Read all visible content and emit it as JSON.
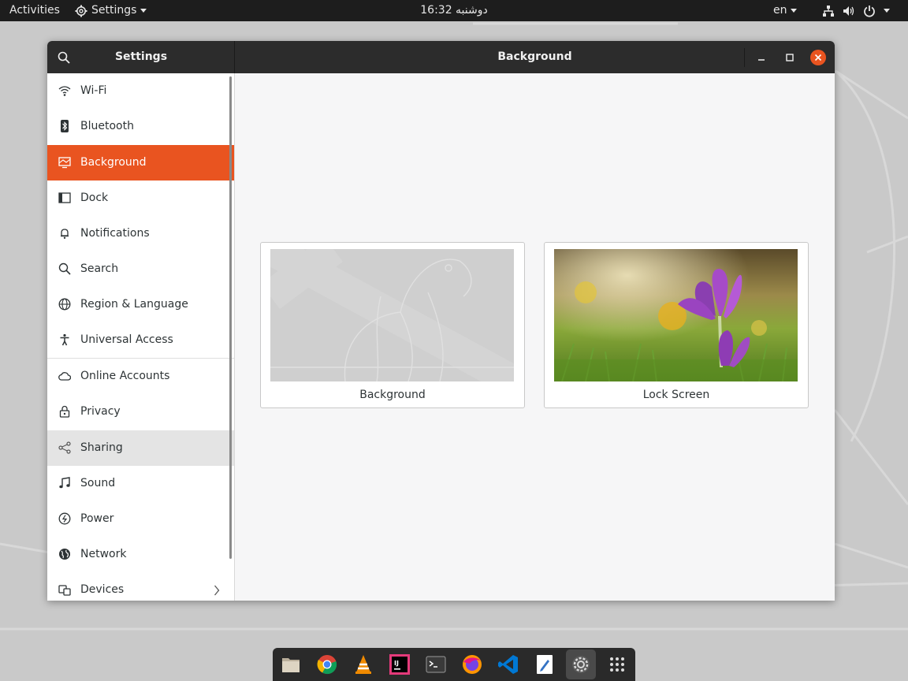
{
  "topbar": {
    "activities": "Activities",
    "app_menu": "Settings",
    "clock": "16:32 دوشنبه",
    "language": "en"
  },
  "window": {
    "sidebar_title": "Settings",
    "panel_title": "Background"
  },
  "sidebar": {
    "items": [
      {
        "label": "Wi-Fi",
        "icon": "wifi-icon"
      },
      {
        "label": "Bluetooth",
        "icon": "bluetooth-icon"
      },
      {
        "label": "Background",
        "icon": "background-icon",
        "state": "selected"
      },
      {
        "label": "Dock",
        "icon": "dock-icon"
      },
      {
        "label": "Notifications",
        "icon": "bell-icon"
      },
      {
        "label": "Search",
        "icon": "search-icon"
      },
      {
        "label": "Region & Language",
        "icon": "globe-icon"
      },
      {
        "label": "Universal Access",
        "icon": "accessibility-icon"
      },
      {
        "label": "Online Accounts",
        "icon": "cloud-icon"
      },
      {
        "label": "Privacy",
        "icon": "lock-icon"
      },
      {
        "label": "Sharing",
        "icon": "share-icon",
        "state": "hover"
      },
      {
        "label": "Sound",
        "icon": "music-note-icon"
      },
      {
        "label": "Power",
        "icon": "power-icon"
      },
      {
        "label": "Network",
        "icon": "network-icon"
      },
      {
        "label": "Devices",
        "icon": "devices-icon"
      }
    ]
  },
  "main": {
    "cards": [
      {
        "caption": "Background"
      },
      {
        "caption": "Lock Screen"
      }
    ]
  },
  "dock": {
    "apps": [
      {
        "name": "files-icon",
        "color": "#c9bfae"
      },
      {
        "name": "chrome-icon",
        "color": "#4285f4"
      },
      {
        "name": "vlc-icon",
        "color": "#f08a00"
      },
      {
        "name": "intellij-icon",
        "color": "#000000"
      },
      {
        "name": "terminal-icon",
        "color": "#2b2b2b"
      },
      {
        "name": "firefox-icon",
        "color": "#e66000"
      },
      {
        "name": "vscode-icon",
        "color": "#0078d4"
      },
      {
        "name": "text-editor-icon",
        "color": "#ffffff"
      },
      {
        "name": "settings-icon",
        "color": "#8a8a8a"
      },
      {
        "name": "show-apps-icon",
        "color": "#dddddd"
      }
    ]
  },
  "colors": {
    "accent": "#e95420",
    "topbar": "#1d1d1d",
    "headerbar": "#2c2c2c"
  }
}
